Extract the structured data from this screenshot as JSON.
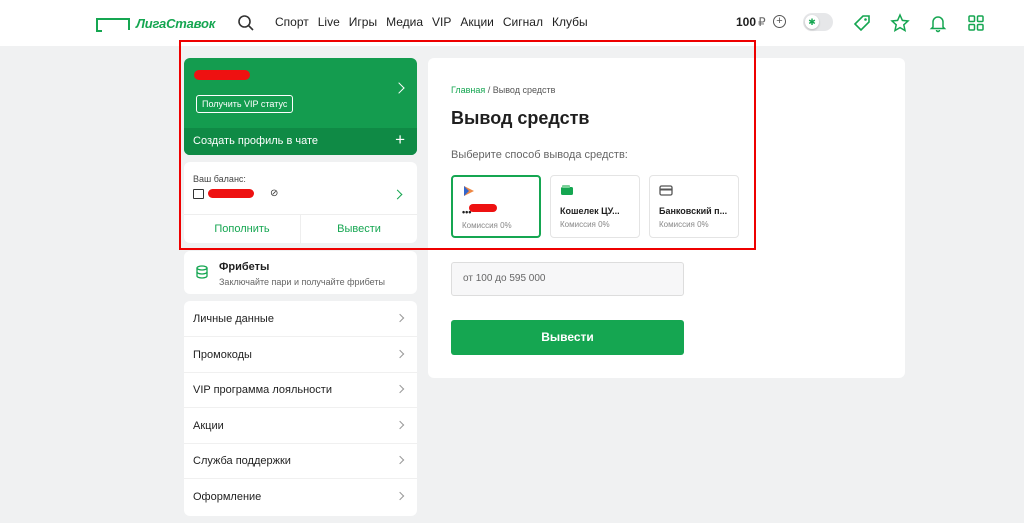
{
  "header": {
    "logo_text": "ЛигаСтавок",
    "nav": [
      "Спорт",
      "Live",
      "Игры",
      "Медиа",
      "VIP",
      "Акции",
      "Сигнал",
      "Клубы"
    ],
    "balance": "100",
    "currency": "₽",
    "icons": [
      "search-icon",
      "plus-circle-icon",
      "theme-toggle",
      "coupon-icon",
      "star-icon",
      "bell-icon",
      "grid-icon"
    ]
  },
  "profile": {
    "vip_button": "Получить VIP статус",
    "chat_profile": "Создать профиль в чате",
    "balance_label": "Ваш баланс:",
    "topup": "Пополнить",
    "withdraw": "Вывести"
  },
  "freebets": {
    "title": "Фрибеты",
    "subtitle": "Заключайте пари и получайте фрибеты"
  },
  "menu": [
    "Личные данные",
    "Промокоды",
    "VIP программа лояльности",
    "Акции",
    "Служба поддержки",
    "Оформление"
  ],
  "main": {
    "breadcrumb_home": "Главная",
    "breadcrumb_sep": " / ",
    "breadcrumb_current": "Вывод средств",
    "title": "Вывод средств",
    "subtitle": "Выберите способ вывода средств:",
    "methods": [
      {
        "name": "•••",
        "commission": "Комиссия 0%",
        "selected": true
      },
      {
        "name": "Кошелек ЦУ...",
        "commission": "Комиссия 0%",
        "selected": false
      },
      {
        "name": "Банковский п...",
        "commission": "Комиссия 0%",
        "selected": false
      }
    ],
    "amount_placeholder": "от 100 до 595 000",
    "submit": "Вывести"
  },
  "colors": {
    "accent": "#15a651",
    "highlight": "#e00000"
  }
}
